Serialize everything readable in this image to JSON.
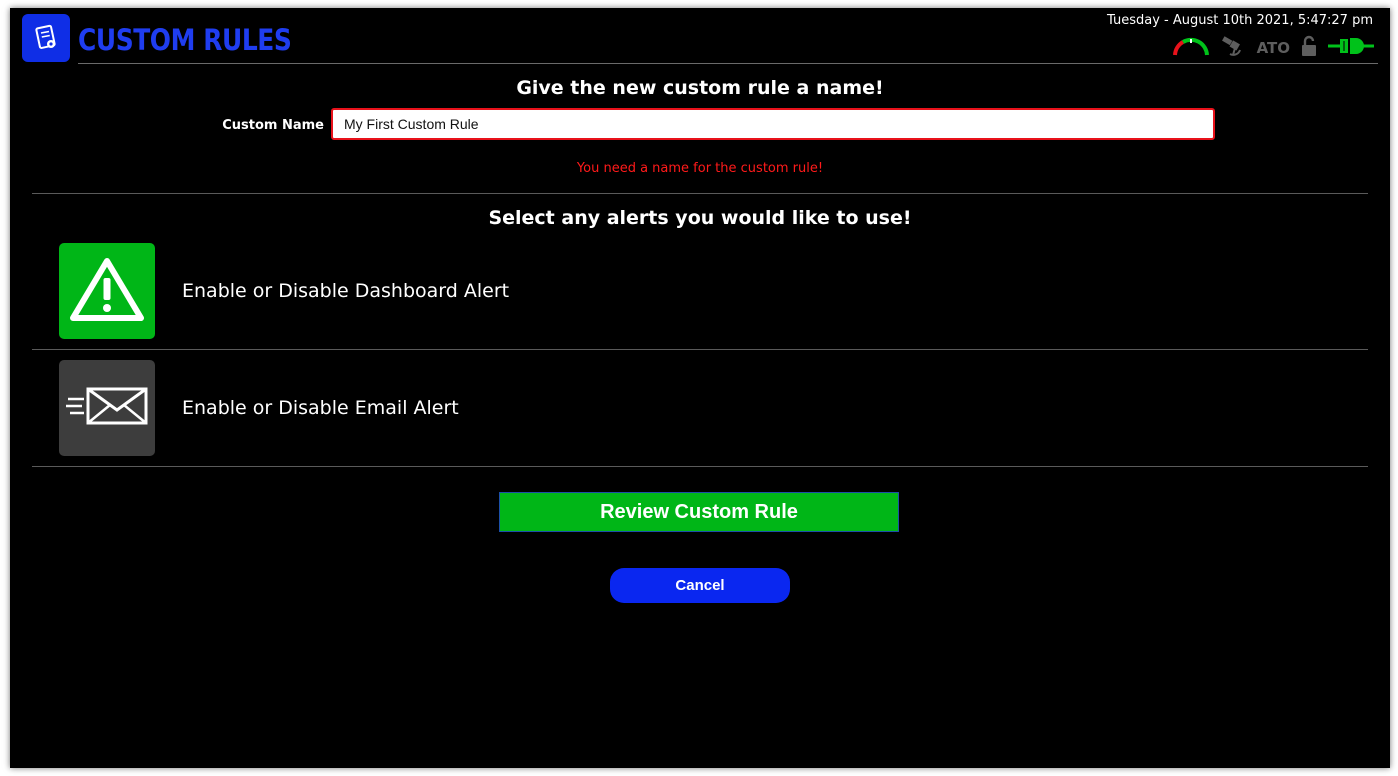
{
  "header": {
    "title": "CUSTOM RULES",
    "logo_icon": "custom-rules-document-icon",
    "datetime": "Tuesday - August 10th 2021, 5:47:27 pm",
    "status_icons": {
      "gauge": "gauge-icon",
      "satellite": "satellite-icon",
      "ato_label": "ATO",
      "lock": "unlock-icon",
      "plug": "plug-connected-icon"
    }
  },
  "name_section": {
    "heading": "Give the new custom rule a name!",
    "label": "Custom Name",
    "value": "My First Custom Rule",
    "error": "You need a name for the custom rule!"
  },
  "alerts_section": {
    "heading": "Select any alerts you would like to use!",
    "items": [
      {
        "label": "Enable or Disable Dashboard Alert",
        "icon": "warning-icon",
        "enabled": true,
        "tile_color": "#00b617"
      },
      {
        "label": "Enable or Disable Email Alert",
        "icon": "email-icon",
        "enabled": false,
        "tile_color": "#3d3d3d"
      }
    ]
  },
  "actions": {
    "review_label": "Review Custom Rule",
    "cancel_label": "Cancel"
  },
  "colors": {
    "accent_blue": "#1f3df0",
    "success_green": "#00b617",
    "error_red": "#ff1a1a",
    "background": "#000000"
  }
}
